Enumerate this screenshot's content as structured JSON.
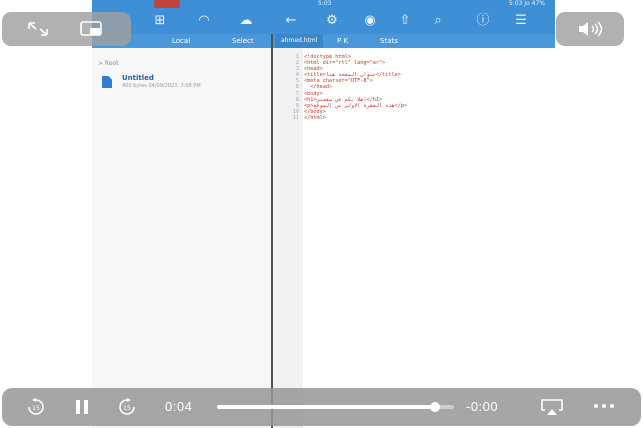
{
  "app": {
    "statusbar": {
      "time": "5:03",
      "right": "5:03 Jo 47%"
    },
    "subbar": {
      "local_label": "Local",
      "select_label": "Select",
      "file_tab": "ahmed.html",
      "edit_label": "P  K",
      "view_label": "Stats"
    },
    "left": {
      "breadcrumb": "> Root",
      "file_name": "Untitled",
      "file_meta": "400 bytes 04/09/2023, 3:08 PM"
    },
    "editor": {
      "lines": [
        {
          "n": "1",
          "text": "<!doctype html>"
        },
        {
          "n": "2",
          "text": "<html dir=\"rtl\" lang=\"ar\">"
        },
        {
          "n": "3",
          "text": "<head>"
        },
        {
          "n": "4",
          "text": "<title>عنوان الصفحة هنا</title>"
        },
        {
          "n": "5",
          "text": "<meta charset=\"UTF-8\">"
        },
        {
          "n": "6",
          "text": "  </head>"
        },
        {
          "n": "7",
          "text": "<body>"
        },
        {
          "n": "8",
          "text": "<h1>اهلا بكم في صفحتي</h1>"
        },
        {
          "n": "9",
          "text": "<p>هذه الفقرة الاولى من الموقع</p>"
        },
        {
          "n": "10",
          "text": "</body>"
        },
        {
          "n": "11",
          "text": "</html>"
        }
      ]
    }
  },
  "player": {
    "elapsed": "0:04",
    "remaining": "-0:00",
    "progress": 0.92
  },
  "icons": {
    "fullscreen": "fullscreen-icon",
    "pip": "picture-in-picture-icon",
    "volume": "volume-icon",
    "skip_back": "skip-back-15-icon",
    "pause": "pause-icon",
    "skip_forward": "skip-forward-15-icon",
    "airplay": "airplay-icon",
    "more": "more-icon"
  }
}
